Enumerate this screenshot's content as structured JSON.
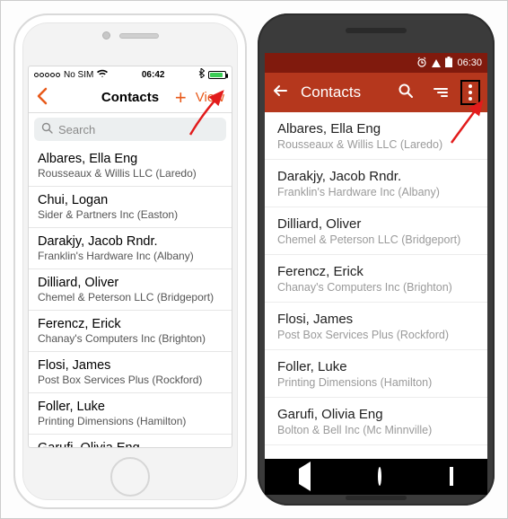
{
  "ios": {
    "status": {
      "carrier": "No SIM",
      "time": "06:42",
      "bt_icon": "✱"
    },
    "nav": {
      "title": "Contacts",
      "view_label": "View"
    },
    "search": {
      "placeholder": "Search"
    },
    "contacts": [
      {
        "name": "Albares, Ella Eng",
        "sub": "Rousseaux & Willis LLC (Laredo)"
      },
      {
        "name": "Chui, Logan",
        "sub": "Sider & Partners Inc (Easton)"
      },
      {
        "name": "Darakjy, Jacob Rndr.",
        "sub": "Franklin's Hardware Inc (Albany)"
      },
      {
        "name": "Dilliard, Oliver",
        "sub": "Chemel & Peterson LLC (Bridgeport)"
      },
      {
        "name": "Ferencz, Erick",
        "sub": "Chanay's Computers Inc (Brighton)"
      },
      {
        "name": "Flosi, James",
        "sub": "Post Box Services Plus (Rockford)"
      },
      {
        "name": "Foller, Luke",
        "sub": "Printing Dimensions (Hamilton)"
      },
      {
        "name": "Garufi, Olivia Eng",
        "sub": ""
      }
    ]
  },
  "android": {
    "status": {
      "time": "06:30"
    },
    "appbar": {
      "title": "Contacts"
    },
    "contacts": [
      {
        "name": "Albares, Ella Eng",
        "sub": "Rousseaux & Willis LLC (Laredo)"
      },
      {
        "name": "Darakjy, Jacob Rndr.",
        "sub": "Franklin's Hardware Inc (Albany)"
      },
      {
        "name": "Dilliard, Oliver",
        "sub": "Chemel & Peterson LLC (Bridgeport)"
      },
      {
        "name": "Ferencz, Erick",
        "sub": "Chanay's Computers Inc (Brighton)"
      },
      {
        "name": "Flosi, James",
        "sub": "Post Box Services Plus (Rockford)"
      },
      {
        "name": "Foller, Luke",
        "sub": "Printing Dimensions (Hamilton)"
      },
      {
        "name": "Garufi, Olivia Eng",
        "sub": "Bolton & Bell Inc (Mc Minnville)"
      }
    ]
  },
  "colors": {
    "android_primary": "#b5371d",
    "android_dark": "#801a0d",
    "ios_accent": "#e85a1a",
    "arrow": "#e21b1b"
  }
}
